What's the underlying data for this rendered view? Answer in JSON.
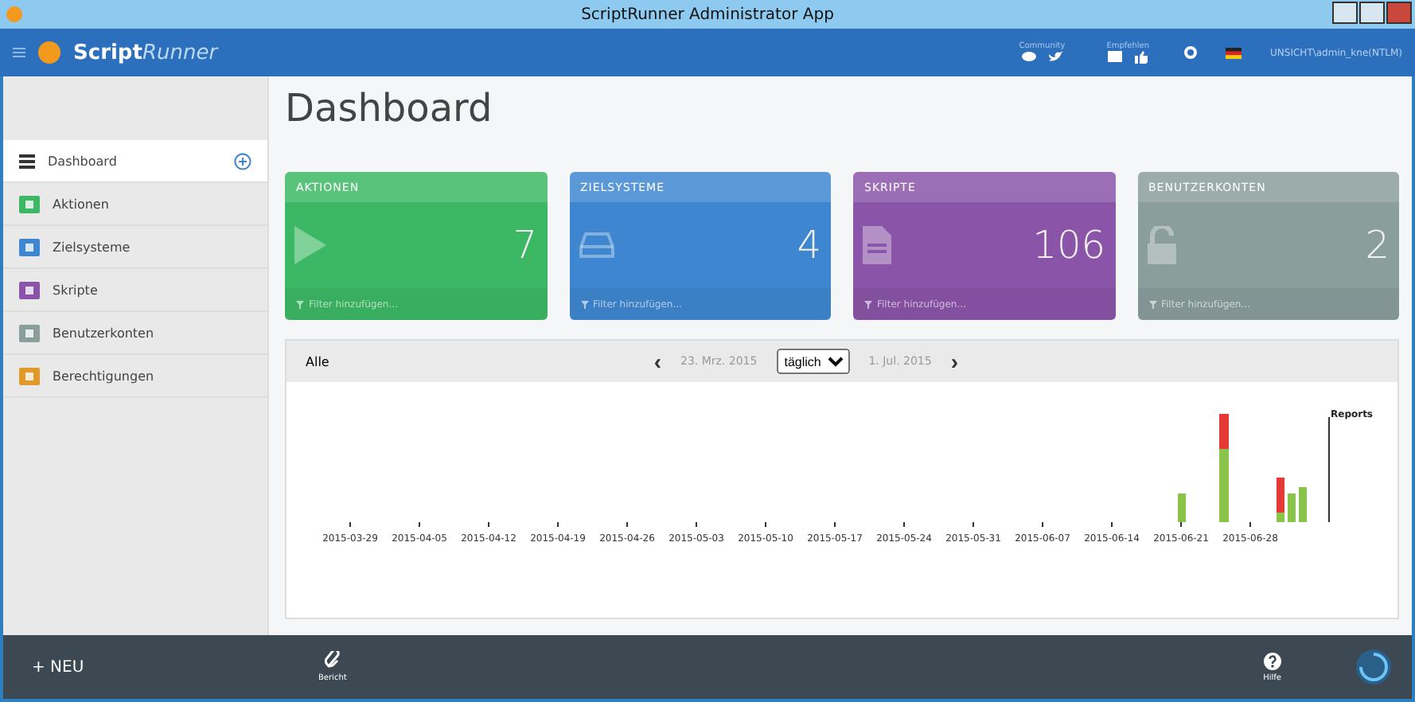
{
  "window": {
    "title": "ScriptRunner Administrator App"
  },
  "app_bar": {
    "logo_main": "Script",
    "logo_accent": "Runner",
    "groups": [
      {
        "label": "Community",
        "icons": [
          {
            "kind": "chat"
          },
          {
            "kind": "bird"
          }
        ]
      },
      {
        "label": "Empfehlen",
        "icons": [
          {
            "kind": "mail"
          },
          {
            "kind": "thumb"
          }
        ]
      }
    ],
    "user": "UNSICHT\\admin_kne(NTLM)"
  },
  "sidebar": {
    "items": [
      {
        "label": "Dashboard",
        "kind": "dashboard",
        "selected": true
      },
      {
        "label": "Aktionen",
        "kind": "actions",
        "selected": false
      },
      {
        "label": "Zielsysteme",
        "kind": "targets",
        "selected": false
      },
      {
        "label": "Skripte",
        "kind": "scripts",
        "selected": false
      },
      {
        "label": "Benutzerkonten",
        "kind": "accounts",
        "selected": false
      },
      {
        "label": "Berechtigungen",
        "kind": "permissions",
        "selected": false
      }
    ]
  },
  "page_title": "Dashboard",
  "cards": [
    {
      "title": "AKTIONEN",
      "count": "7",
      "kind": "actions",
      "color": "#3cb864",
      "filter": "Filter hinzufügen..."
    },
    {
      "title": "ZIELSYSTEME",
      "count": "4",
      "kind": "targets",
      "color": "#3f86d0",
      "filter": "Filter hinzufügen..."
    },
    {
      "title": "SKRIPTE",
      "count": "106",
      "kind": "scripts",
      "color": "#8a55a8",
      "filter": "Filter hinzufügen..."
    },
    {
      "title": "BENUTZERKONTEN",
      "count": "2",
      "kind": "accounts",
      "color": "#8a9e9c",
      "filter": "Filter hinzufügen..."
    }
  ],
  "chart_panel": {
    "filter": "Alle",
    "prev": "‹",
    "start": "23. Mrz. 2015",
    "interval": "täglich",
    "end": "1. Jul. 2015",
    "next": "›",
    "legend": "Reports",
    "x_labels": [
      "2015-03-29",
      "2015-04-05",
      "2015-04-12",
      "2015-04-19",
      "2015-04-26",
      "2015-05-03",
      "2015-05-10",
      "2015-05-17",
      "2015-05-24",
      "2015-05-31",
      "2015-06-07",
      "2015-06-14",
      "2015-06-21",
      "2015-06-28"
    ]
  },
  "bottom_bar": {
    "new_button": "+ NEU",
    "report": "Bericht",
    "help": "Hilfe"
  }
}
